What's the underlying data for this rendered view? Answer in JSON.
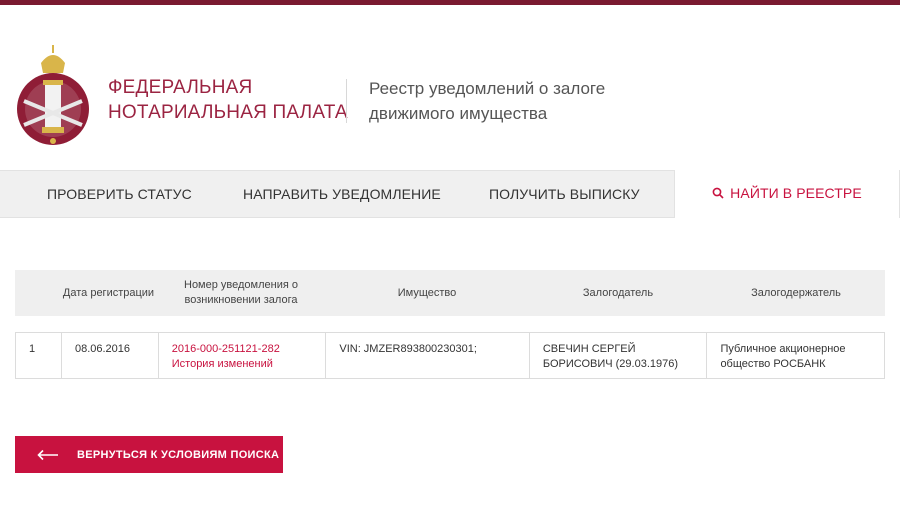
{
  "header": {
    "org_name_line1": "ФЕДЕРАЛЬНАЯ",
    "org_name_line2": "НОТАРИАЛЬНАЯ ПАЛАТА",
    "registry_line1": "Реестр уведомлений о залоге",
    "registry_line2": "движимого имущества"
  },
  "nav": {
    "items": [
      {
        "label": "ПРОВЕРИТЬ СТАТУС"
      },
      {
        "label": "НАПРАВИТЬ УВЕДОМЛЕНИЕ"
      },
      {
        "label": "ПОЛУЧИТЬ ВЫПИСКУ"
      },
      {
        "label": "НАЙТИ В РЕЕСТРЕ",
        "active": true,
        "icon": "search-icon"
      }
    ]
  },
  "table": {
    "headers": [
      "",
      "Дата регистрации",
      "Номер уведомления о возникновении залога",
      "Имущество",
      "Залогодатель",
      "Залогодержатель"
    ],
    "rows": [
      {
        "index": "1",
        "date": "08.06.2016",
        "number": "2016-000-251121-282",
        "history": "История изменений",
        "property": "VIN: JMZER893800230301;",
        "pledgor": "СВЕЧИН СЕРГЕЙ БОРИСОВИЧ (29.03.1976)",
        "pledgee": "Публичное акционерное общество РОСБАНК"
      }
    ]
  },
  "back_button": {
    "label": "ВЕРНУТЬСЯ К УСЛОВИЯМ ПОИСКА",
    "icon": "arrow-left-icon"
  },
  "colors": {
    "brand": "#9b2442",
    "accent": "#c8123f",
    "stripe": "#7a1a30"
  }
}
